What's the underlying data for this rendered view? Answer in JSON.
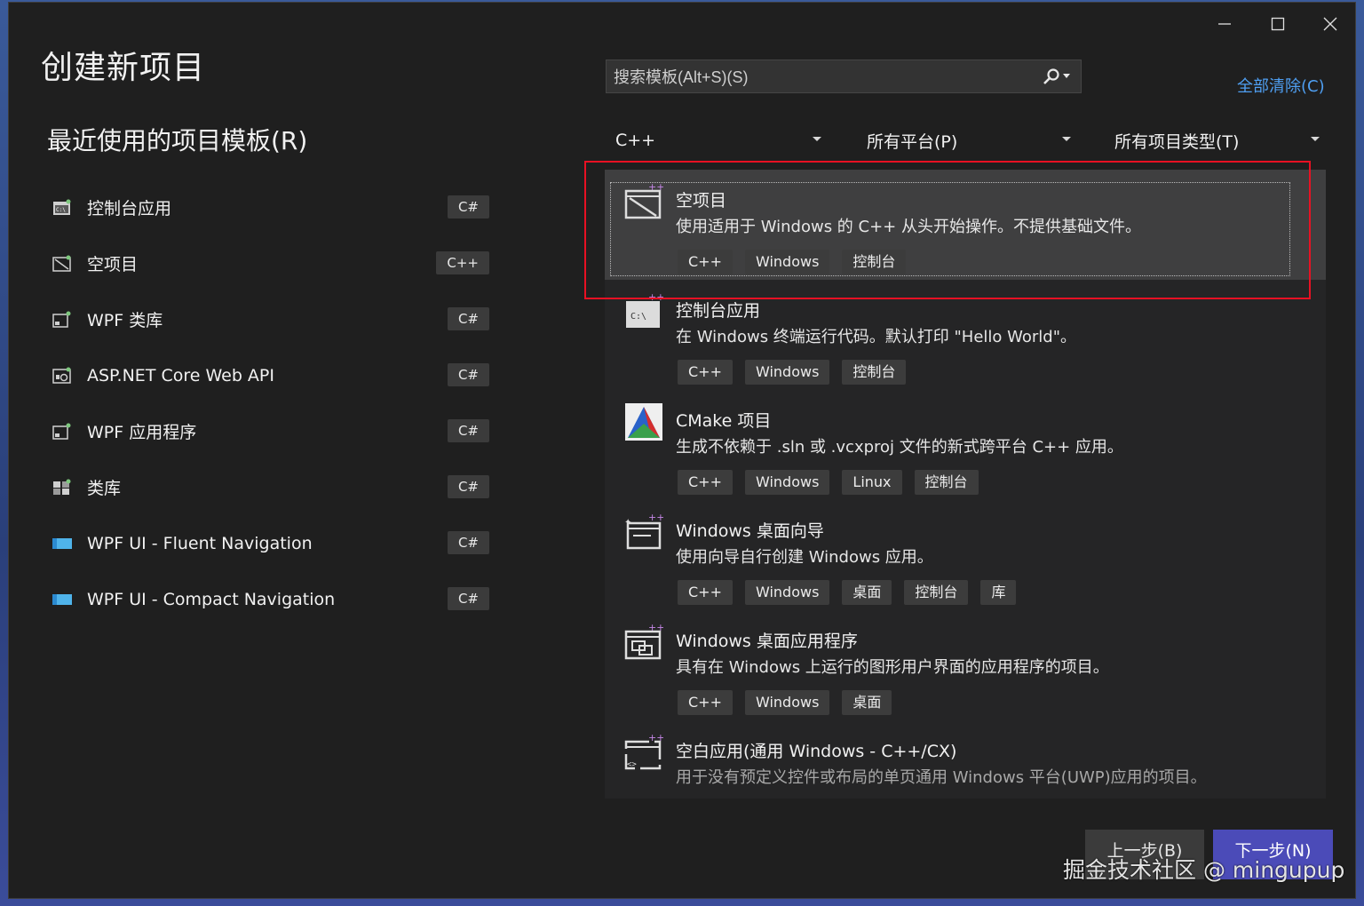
{
  "page_title": "创建新项目",
  "recent": {
    "title": "最近使用的项目模板(R)",
    "items": [
      {
        "label": "控制台应用",
        "lang": "C#",
        "icon": "console-app-icon"
      },
      {
        "label": "空项目",
        "lang": "C++",
        "icon": "empty-project-icon"
      },
      {
        "label": "WPF 类库",
        "lang": "C#",
        "icon": "wpf-library-icon"
      },
      {
        "label": "ASP.NET Core Web API",
        "lang": "C#",
        "icon": "web-api-icon"
      },
      {
        "label": "WPF 应用程序",
        "lang": "C#",
        "icon": "wpf-app-icon"
      },
      {
        "label": "类库",
        "lang": "C#",
        "icon": "class-library-icon"
      },
      {
        "label": "WPF UI - Fluent Navigation",
        "lang": "C#",
        "icon": "wpf-ui-icon"
      },
      {
        "label": "WPF UI - Compact Navigation",
        "lang": "C#",
        "icon": "wpf-ui-icon"
      }
    ]
  },
  "search": {
    "placeholder": "搜索模板(Alt+S)(S)"
  },
  "clear_all": "全部清除(C)",
  "filters": {
    "language": "C++",
    "platform": "所有平台(P)",
    "project_type": "所有项目类型(T)"
  },
  "results": [
    {
      "title": "空项目",
      "desc": "使用适用于 Windows 的 C++ 从头开始操作。不提供基础文件。",
      "tags": [
        "C++",
        "Windows",
        "控制台"
      ],
      "icon": "empty-project-icon",
      "selected": true
    },
    {
      "title": "控制台应用",
      "desc": "在 Windows 终端运行代码。默认打印 \"Hello World\"。",
      "tags": [
        "C++",
        "Windows",
        "控制台"
      ],
      "icon": "console-app-icon"
    },
    {
      "title": "CMake 项目",
      "desc": "生成不依赖于 .sln 或 .vcxproj 文件的新式跨平台 C++ 应用。",
      "tags": [
        "C++",
        "Windows",
        "Linux",
        "控制台"
      ],
      "icon": "cmake-icon"
    },
    {
      "title": "Windows 桌面向导",
      "desc": "使用向导自行创建 Windows 应用。",
      "tags": [
        "C++",
        "Windows",
        "桌面",
        "控制台",
        "库"
      ],
      "icon": "desktop-wizard-icon"
    },
    {
      "title": "Windows 桌面应用程序",
      "desc": "具有在 Windows 上运行的图形用户界面的应用程序的项目。",
      "tags": [
        "C++",
        "Windows",
        "桌面"
      ],
      "icon": "desktop-app-icon"
    },
    {
      "title": "空白应用(通用 Windows - C++/CX)",
      "desc": "用于没有预定义控件或布局的单页通用 Windows 平台(UWP)应用的项目。",
      "tags": [],
      "icon": "uwp-app-icon"
    }
  ],
  "buttons": {
    "back": "上一步(B)",
    "next": "下一步(N)"
  },
  "watermark": "掘金技术社区 @ mingupup",
  "colors": {
    "accent": "#4b4bb8",
    "link": "#4f9ff2",
    "highlight": "#e81123"
  }
}
